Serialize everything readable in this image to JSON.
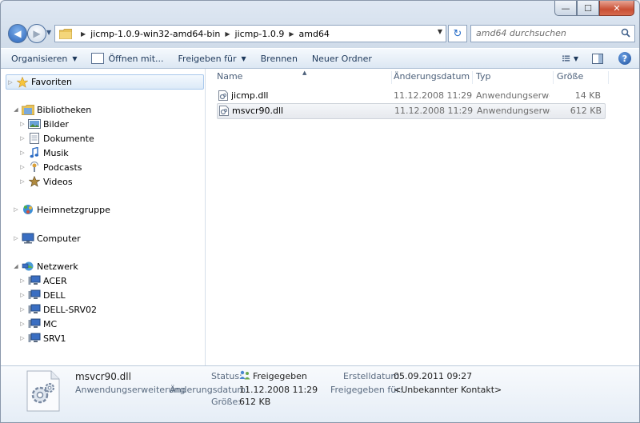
{
  "window": {
    "caption_min": "—",
    "caption_max": "☐",
    "caption_close": "✕"
  },
  "address": {
    "breadcrumbs": [
      "jicmp-1.0.9-win32-amd64-bin",
      "jicmp-1.0.9",
      "amd64"
    ]
  },
  "search": {
    "placeholder": "amd64 durchsuchen"
  },
  "toolbar": {
    "organize": "Organisieren",
    "open_with": "Öffnen mit...",
    "share": "Freigeben für",
    "burn": "Brennen",
    "new_folder": "Neuer Ordner",
    "help": "?"
  },
  "nav": {
    "favorites": "Favoriten",
    "libraries": "Bibliotheken",
    "library_items": [
      "Bilder",
      "Dokumente",
      "Musik",
      "Podcasts",
      "Videos"
    ],
    "homegroup": "Heimnetzgruppe",
    "computer": "Computer",
    "network": "Netzwerk",
    "network_items": [
      "ACER",
      "DELL",
      "DELL-SRV02",
      "MC",
      "SRV1"
    ]
  },
  "columns": {
    "name": "Name",
    "date": "Änderungsdatum",
    "type": "Typ",
    "size": "Größe"
  },
  "files": [
    {
      "name": "jicmp.dll",
      "date": "11.12.2008 11:29",
      "type": "Anwendungserwe...",
      "size": "14 KB"
    },
    {
      "name": "msvcr90.dll",
      "date": "11.12.2008 11:29",
      "type": "Anwendungserwe...",
      "size": "612 KB"
    }
  ],
  "details": {
    "filename": "msvcr90.dll",
    "filetype": "Anwendungserweiterung",
    "status_label": "Status:",
    "status_value": "Freigegeben",
    "modified_label": "Änderungsdatum:",
    "modified_value": "11.12.2008 11:29",
    "size_label": "Größe:",
    "size_value": "612 KB",
    "created_label": "Erstelldatum:",
    "created_value": "05.09.2011 09:27",
    "shared_label": "Freigegeben für:",
    "shared_value": "<Unbekannter Kontakt>"
  },
  "colors": {
    "accent": "#1e395b",
    "selection": "#dceaf8"
  }
}
